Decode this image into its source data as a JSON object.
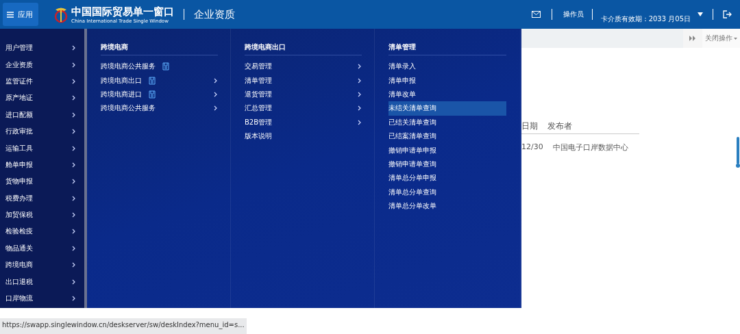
{
  "header": {
    "app_button": "应用",
    "logo_title": "中国国际贸易单一窗口",
    "logo_subtitle": "China International Trade Single Window",
    "page_title": "企业资质",
    "user_role": "操作员",
    "card_expiry": "卡介质有效期：2033 月05日"
  },
  "sidebar": {
    "items": [
      "用户管理",
      "企业资质",
      "监管证件",
      "原产地证",
      "进口配额",
      "行政审批",
      "运输工具",
      "舱单申报",
      "货物申报",
      "税费办理",
      "加贸保税",
      "检验检疫",
      "物品通关",
      "跨境电商",
      "出口退税",
      "口岸物流"
    ]
  },
  "menu": {
    "columns": [
      {
        "heading": "跨境电商",
        "items": [
          {
            "label": "跨境电商公共服务",
            "has_icon": true,
            "has_submenu": false,
            "selected": false
          },
          {
            "label": "跨境电商出口",
            "has_icon": true,
            "has_submenu": true,
            "selected": false
          },
          {
            "label": "跨境电商进口",
            "has_icon": true,
            "has_submenu": true,
            "selected": false
          },
          {
            "label": "跨境电商公共服务",
            "has_icon": false,
            "has_submenu": true,
            "selected": false
          }
        ]
      },
      {
        "heading": "跨境电商出口",
        "items": [
          {
            "label": "交易管理",
            "has_icon": false,
            "has_submenu": true,
            "selected": false
          },
          {
            "label": "清单管理",
            "has_icon": false,
            "has_submenu": true,
            "selected": false
          },
          {
            "label": "退货管理",
            "has_icon": false,
            "has_submenu": true,
            "selected": false
          },
          {
            "label": "汇总管理",
            "has_icon": false,
            "has_submenu": true,
            "selected": false
          },
          {
            "label": "B2B管理",
            "has_icon": false,
            "has_submenu": true,
            "selected": false
          },
          {
            "label": "版本说明",
            "has_icon": false,
            "has_submenu": false,
            "selected": false
          }
        ]
      },
      {
        "heading": "清单管理",
        "items": [
          {
            "label": "清单录入",
            "has_icon": false,
            "has_submenu": false,
            "selected": false
          },
          {
            "label": "清单申报",
            "has_icon": false,
            "has_submenu": false,
            "selected": false
          },
          {
            "label": "清单改单",
            "has_icon": false,
            "has_submenu": false,
            "selected": false
          },
          {
            "label": "未结关清单查询",
            "has_icon": false,
            "has_submenu": false,
            "selected": true
          },
          {
            "label": "已结关清单查询",
            "has_icon": false,
            "has_submenu": false,
            "selected": false
          },
          {
            "label": "已结案清单查询",
            "has_icon": false,
            "has_submenu": false,
            "selected": false
          },
          {
            "label": "撤销申请单申报",
            "has_icon": false,
            "has_submenu": false,
            "selected": false
          },
          {
            "label": "撤销申请单查询",
            "has_icon": false,
            "has_submenu": false,
            "selected": false
          },
          {
            "label": "清单总分单申报",
            "has_icon": false,
            "has_submenu": false,
            "selected": false
          },
          {
            "label": "清单总分单查询",
            "has_icon": false,
            "has_submenu": false,
            "selected": false
          },
          {
            "label": "清单总分单改单",
            "has_icon": false,
            "has_submenu": false,
            "selected": false
          }
        ]
      }
    ]
  },
  "tab_bar": {
    "close_menu": "关闭操作"
  },
  "table": {
    "columns": [
      "日期",
      "发布者"
    ],
    "rows": [
      [
        "12/30",
        "中国电子口岸数据中心"
      ]
    ]
  },
  "status_url": "https://swapp.singlewindow.cn/deskserver/sw/deskIndex?menu_id=s..."
}
